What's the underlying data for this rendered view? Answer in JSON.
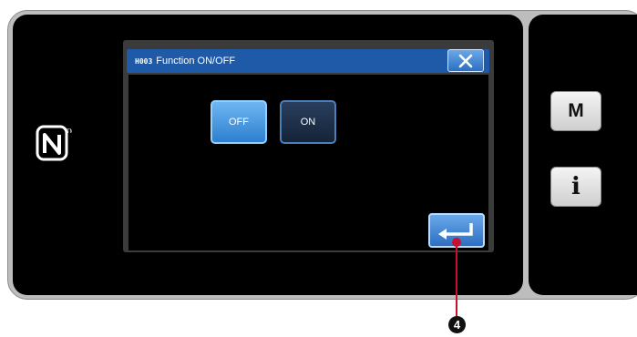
{
  "device": {
    "nfc_icon": "nfc-n-mark-icon",
    "side_buttons": {
      "mode_label": "M",
      "info_label": "i"
    }
  },
  "dialog": {
    "title_code": "H003",
    "title_text": "Function ON/OFF",
    "close_icon": "close-x-icon",
    "off_label": "OFF",
    "on_label": "ON",
    "enter_icon": "enter-return-arrow-icon",
    "selected": "OFF"
  },
  "callout": {
    "number": "4"
  },
  "colors": {
    "title_bar": "#1f5aa8",
    "button_selected": "#3d8fe0",
    "button_unselected": "#1b2d47",
    "callout": "#c8102e"
  }
}
